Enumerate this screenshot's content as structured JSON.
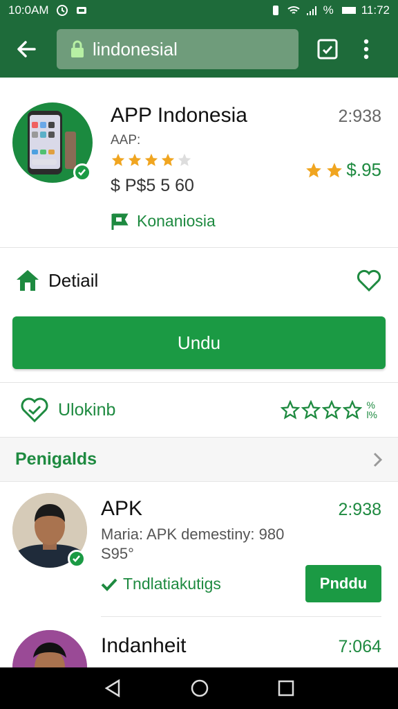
{
  "status_bar": {
    "time": "10:0AM",
    "clock": "11:72",
    "battery": "%"
  },
  "app_bar": {
    "url_text": "lindonesial"
  },
  "app_header": {
    "title": "APP Indonesia",
    "subtitle": "AAP:",
    "rating_stars": 4,
    "price": "$ P$5 5 60",
    "developer": "Konaniosia",
    "count": "2:938",
    "price_right": "$.95",
    "price_right_stars": 2
  },
  "detail": {
    "label": "Detiail"
  },
  "install_button": {
    "label": "Undu"
  },
  "rate_row": {
    "label": "Ulokinb",
    "stars": 4,
    "pct_top": "%",
    "pct_bottom": "l%"
  },
  "section": {
    "title": "Penigalds"
  },
  "list": [
    {
      "title": "APK",
      "meta_line1": "Maria:  APK demestiny: 980",
      "meta_line2": "S95°",
      "count": "2:938",
      "tag": "Tndlatiakutigs",
      "button": "Pnddu"
    },
    {
      "title": "Indanheit",
      "count": "7:064"
    }
  ],
  "colors": {
    "primary": "#1e6b3a",
    "accent": "#1b9a44",
    "star": "#f0a520"
  }
}
